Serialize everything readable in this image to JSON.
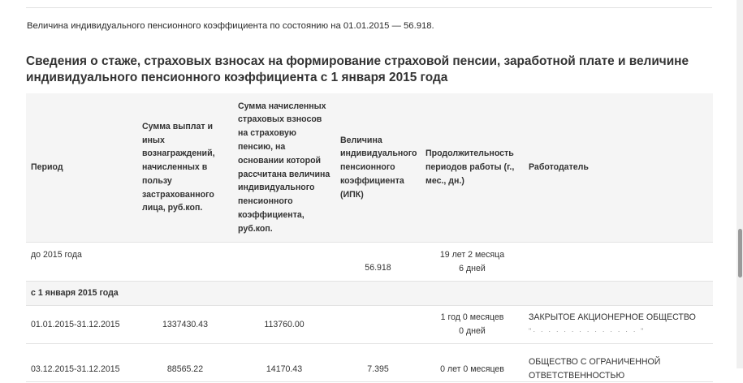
{
  "ipk_note": "Величина индивидуального пенсионного коэффициента по состоянию на 01.01.2015 — 56.918.",
  "section_title": "Сведения о стаже, страховых взносах на формирование страховой пенсии, заработной плате и величине индивидуального пенсионного коэффициента с 1 января 2015 года",
  "table": {
    "headers": [
      "Период",
      "Сумма выплат и иных вознаграждений, начисленных в пользу застрахованного лица, руб.коп.",
      "Сумма начисленных страховых взносов на страховую пенсию, на основании которой рассчитана величина индивидуального пенсионного коэффициента, руб.коп.",
      "Величина индивидуального пенсионного коэффициента (ИПК)",
      "Продолжительность периодов работы (г., мес., дн.)",
      "Работодатель"
    ],
    "pre2015": {
      "period": "до 2015 года",
      "ipk": "56.918",
      "duration_line1": "19 лет 2 месяца",
      "duration_line2": "6 дней"
    },
    "group_label": "с 1 января 2015 года",
    "row1": {
      "period": "01.01.2015-31.12.2015",
      "payments": "1337430.43",
      "contributions": "113760.00",
      "duration_line1": "1 год 0 месяцев",
      "duration_line2": "0 дней",
      "employer": "ЗАКРЫТОЕ АКЦИОНЕРНОЕ ОБЩЕСТВО"
    },
    "row2": {
      "period": "03.12.2015-31.12.2015",
      "payments": "88565.22",
      "contributions": "14170.43",
      "ipk": "7.395",
      "duration_line1": "0 лет 0 месяцев",
      "employer_line1": "ОБЩЕСТВО С ОГРАНИЧЕННОЙ",
      "employer_line2": "ОТВЕТСТВЕННОСТЬЮ"
    }
  }
}
